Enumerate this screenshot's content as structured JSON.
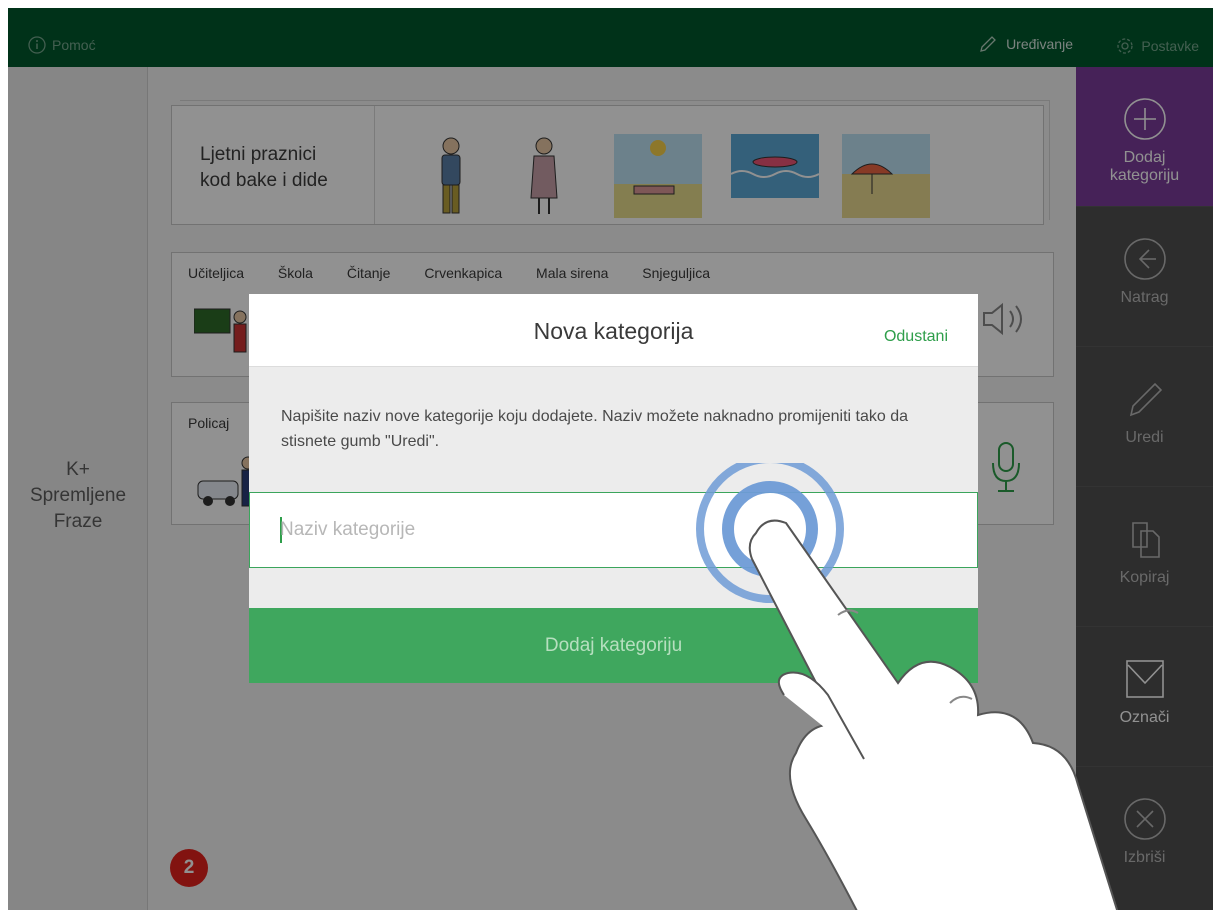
{
  "topbar": {
    "help_label": "Pomoć",
    "edit_label": "Uređivanje",
    "settings_label": "Postavke"
  },
  "left_pane": {
    "saved_phrases_lines": [
      "K+",
      "Spremljene",
      "Fraze"
    ]
  },
  "sidebar": {
    "items": [
      {
        "label_line1": "Dodaj",
        "label_line2": "kategoriju",
        "icon": "plus-circle-icon",
        "active": true
      },
      {
        "label_line1": "Natrag",
        "label_line2": "",
        "icon": "arrow-left-circle-icon"
      },
      {
        "label_line1": "Uredi",
        "label_line2": "",
        "icon": "pencil-icon"
      },
      {
        "label_line1": "Kopiraj",
        "label_line2": "",
        "icon": "copy-icon"
      },
      {
        "label_line1": "Označi",
        "label_line2": "",
        "icon": "checkbox-icon"
      },
      {
        "label_line1": "Izbriši",
        "label_line2": "",
        "icon": "x-circle-icon"
      }
    ]
  },
  "categories": {
    "first": {
      "title_line1": "Ljetni praznici",
      "title_line2": "kod bake i dide"
    },
    "second": {
      "words": [
        "Učiteljica",
        "Škola",
        "Čitanje",
        "Crvenkapica",
        "Mala sirena",
        "Snjeguljica"
      ]
    },
    "third": {
      "words": [
        "Policaj"
      ]
    }
  },
  "step_badge": "2",
  "dialog": {
    "title": "Nova kategorija",
    "cancel_label": "Odustani",
    "description": "Napišite naziv nove kategorije koju dodajete. Naziv možete naknadno promijeniti tako da stisnete gumb \"Uredi\".",
    "input_value": "",
    "input_placeholder": "Naziv kategorije",
    "submit_label": "Dodaj kategoriju"
  },
  "colors": {
    "topbar": "#00582d",
    "accent_green": "#3fa75e",
    "sidebar_active": "#7b3c9b",
    "badge": "#e5231d"
  }
}
